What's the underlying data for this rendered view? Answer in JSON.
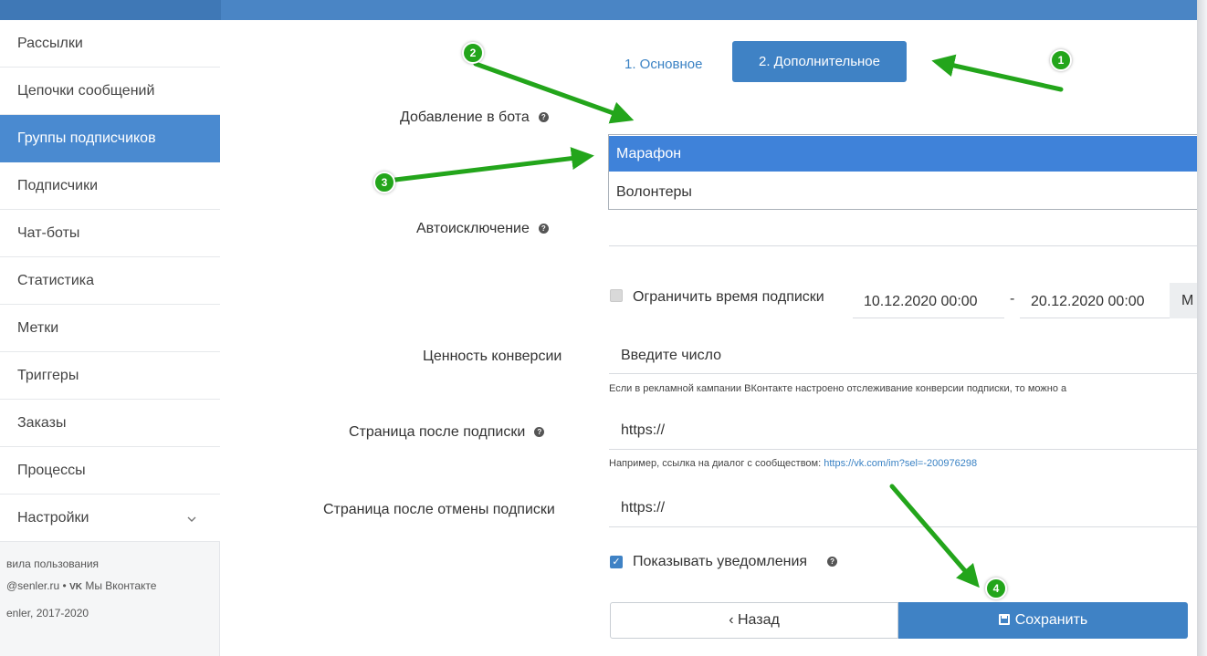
{
  "sidebar": {
    "items": [
      {
        "label": "Рассылки"
      },
      {
        "label": "Цепочки сообщений"
      },
      {
        "label": "Группы подписчиков"
      },
      {
        "label": "Подписчики"
      },
      {
        "label": "Чат-боты"
      },
      {
        "label": "Статистика"
      },
      {
        "label": "Метки"
      },
      {
        "label": "Триггеры"
      },
      {
        "label": "Заказы"
      },
      {
        "label": "Процессы"
      },
      {
        "label": "Настройки"
      }
    ],
    "active_index": 2,
    "footer": {
      "rules": "вила пользования",
      "contacts_email": "@senler.ru •",
      "vk_icon": "VK",
      "vk_label": "Мы Вконтакте",
      "copyright": "enler, 2017-2020"
    }
  },
  "tabs": {
    "basic": "1. Основное",
    "extra": "2. Дополнительное"
  },
  "form": {
    "add_to_bot_label": "Добавление в бота",
    "bot_options": [
      "Марафон",
      "Волонтеры"
    ],
    "selected_bot": "Марафон",
    "auto_exclusion_label": "Автоисключение",
    "limit_time_label": "Ограничить время подписки",
    "limit_time_checked": false,
    "date_from": "10.12.2020 00:00",
    "date_sep": "-",
    "date_to": "20.12.2020 00:00",
    "m_button": "М",
    "conversion_label": "Ценность конверсии",
    "conversion_placeholder": "Введите число",
    "conversion_hint": "Если в рекламной кампании ВКонтакте настроено отслеживание конверсии подписки, то можно а",
    "after_sub_label": "Страница после подписки",
    "after_sub_value": "https://",
    "after_sub_hint_text": "Например, ссылка на диалог с сообществом:",
    "after_sub_hint_link": "https://vk.com/im?sel=-200976298",
    "after_unsub_label": "Страница после отмены подписки",
    "after_unsub_value": "https://",
    "show_notifications_label": "Показывать уведомления",
    "show_notifications_checked": true
  },
  "buttons": {
    "back": "‹ Назад",
    "save": "Сохранить"
  },
  "annotations": {
    "badges": [
      "1",
      "2",
      "3",
      "4"
    ],
    "color": "#23a51b"
  },
  "colors": {
    "accent": "#3f82c5",
    "selection": "#3f82d9",
    "annotation": "#23a51b"
  }
}
